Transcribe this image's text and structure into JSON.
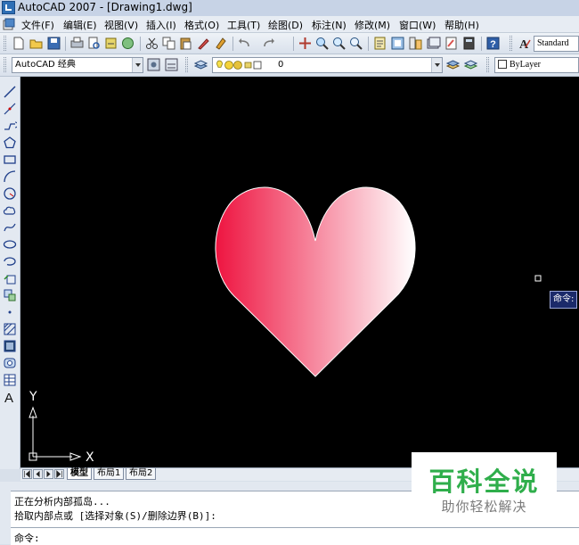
{
  "window": {
    "title": "AutoCAD 2007 - [Drawing1.dwg]"
  },
  "menubar": {
    "items": [
      "文件(F)",
      "编辑(E)",
      "视图(V)",
      "插入(I)",
      "格式(O)",
      "工具(T)",
      "绘图(D)",
      "标注(N)",
      "修改(M)",
      "窗口(W)",
      "帮助(H)"
    ]
  },
  "toolbar": {
    "text_style": "Standard"
  },
  "properties_bar": {
    "workspace": "AutoCAD 经典",
    "layer": "0",
    "color": "ByLayer"
  },
  "canvas": {
    "command_tooltip": "命令:",
    "ucs_x_label": "X",
    "ucs_y_label": "Y",
    "heart_gradient": {
      "from": "#ee1440",
      "to": "#ffffff"
    }
  },
  "tabs": [
    {
      "label": "模型",
      "active": true
    },
    {
      "label": "布局1",
      "active": false
    },
    {
      "label": "布局2",
      "active": false
    }
  ],
  "command": {
    "history": [
      "正在分析内部孤岛...",
      "拾取内部点或 [选择对象(S)/删除边界(B)]:"
    ],
    "prompt": "命令:"
  },
  "watermark": {
    "title": "百科全说",
    "subtitle": "助你轻松解决"
  }
}
